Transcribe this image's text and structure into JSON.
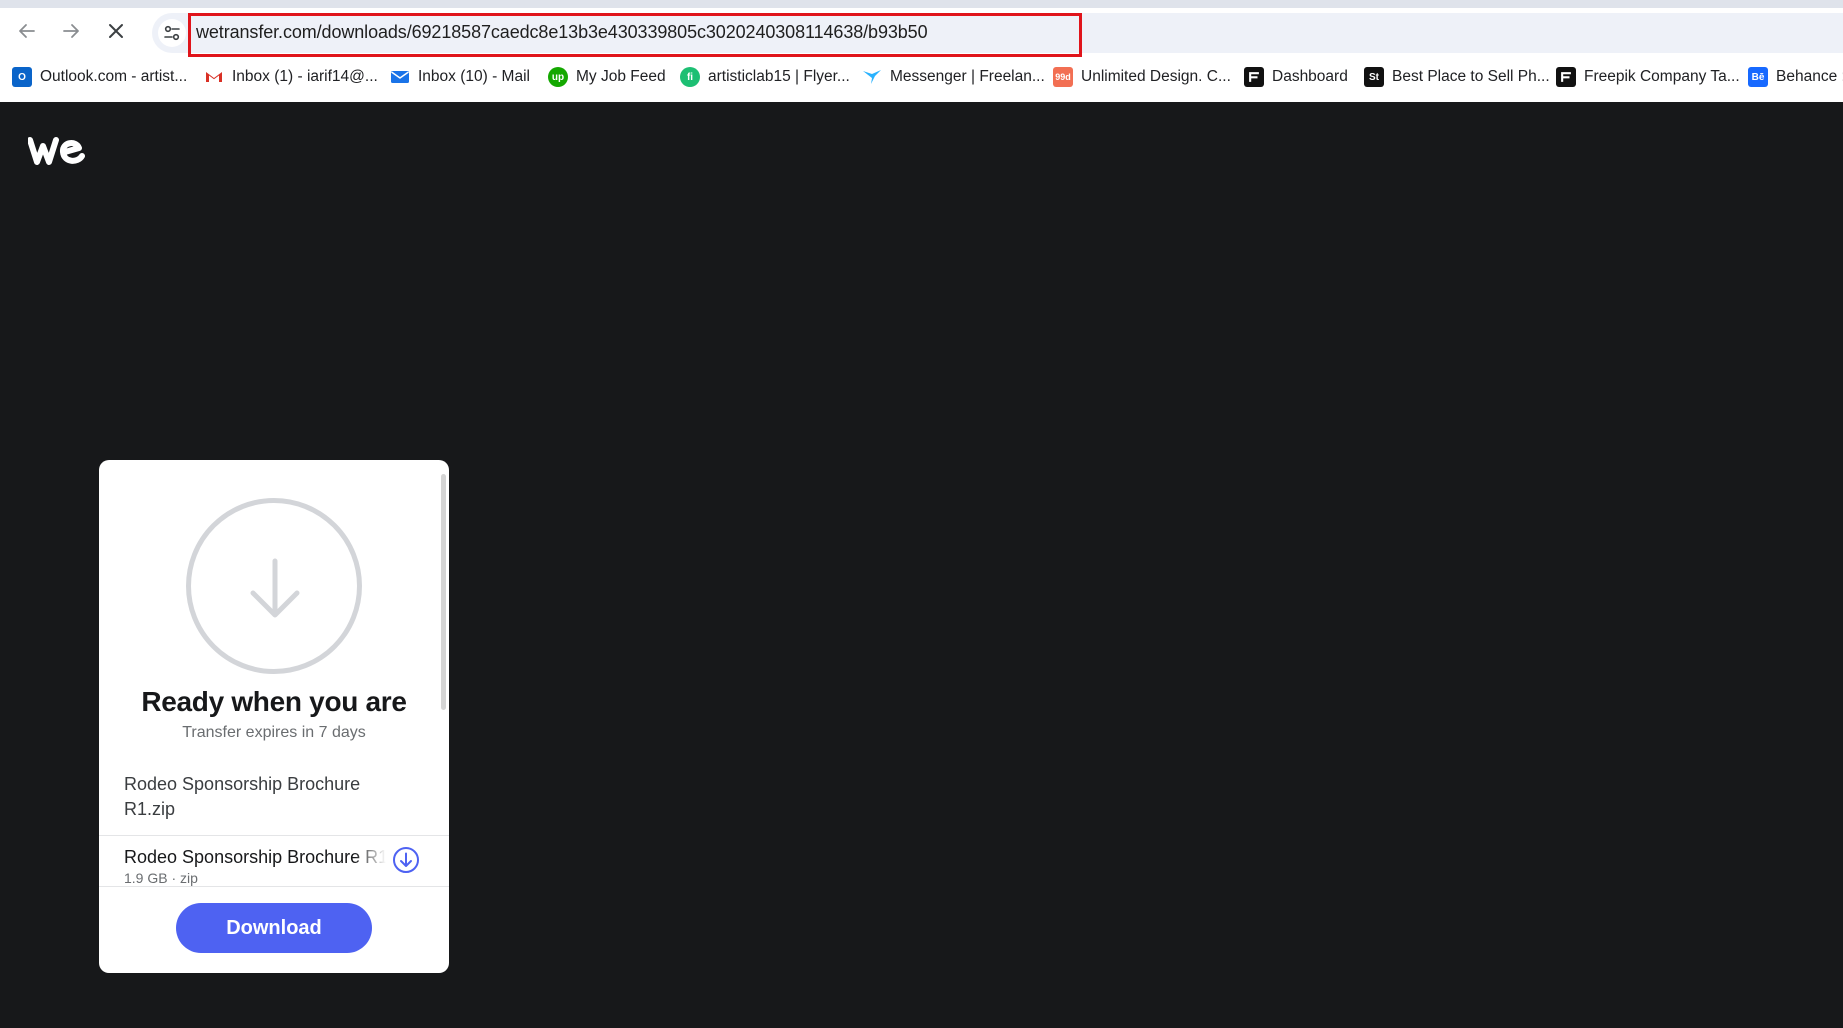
{
  "browser": {
    "url": "wetransfer.com/downloads/69218587caedc8e13b3e430339805c3020240308114638/b93b50",
    "bookmarks": [
      {
        "label": "Outlook.com - artist...",
        "icon": "outlook-icon",
        "color": "#0a64c9"
      },
      {
        "label": "Inbox (1) - iarif14@...",
        "icon": "gmail-icon",
        "color": "#d93025"
      },
      {
        "label": "Inbox (10) - Mail",
        "icon": "mail-icon",
        "color": "#1a73e8"
      },
      {
        "label": "My Job Feed",
        "icon": "upwork-icon",
        "color": "#14a800"
      },
      {
        "label": "artisticlab15 | Flyer...",
        "icon": "fiverr-icon",
        "color": "#1dbf73"
      },
      {
        "label": "Messenger | Freelan...",
        "icon": "freelancer-icon",
        "color": "#29b2fe"
      },
      {
        "label": "Unlimited Design. C...",
        "icon": "99designs-icon",
        "color": "#f26f53"
      },
      {
        "label": "Dashboard",
        "icon": "dashboard-icon",
        "color": "#111111"
      },
      {
        "label": "Best Place to Sell Ph...",
        "icon": "shutterstock-icon",
        "color": "#111111"
      },
      {
        "label": "Freepik Company Ta...",
        "icon": "freepik-icon",
        "color": "#111111"
      },
      {
        "label": "Behance ::",
        "icon": "behance-icon",
        "color": "#1769ff"
      }
    ],
    "bookmark_glyphs": {
      "shutterstock": "St",
      "behance": "Bē",
      "ninety_nine": "99d"
    }
  },
  "card": {
    "title": "Ready when you are",
    "subtitle": "Transfer expires in 7 days",
    "transfer_name": "Rodeo Sponsorship Brochure R1.zip",
    "file": {
      "name": "Rodeo Sponsorship Brochure R1.zip",
      "meta": "1.9 GB · zip"
    },
    "download_label": "Download"
  },
  "colors": {
    "page_bg": "#17181a",
    "accent": "#4e62f2",
    "url_highlight": "#e0141b"
  }
}
